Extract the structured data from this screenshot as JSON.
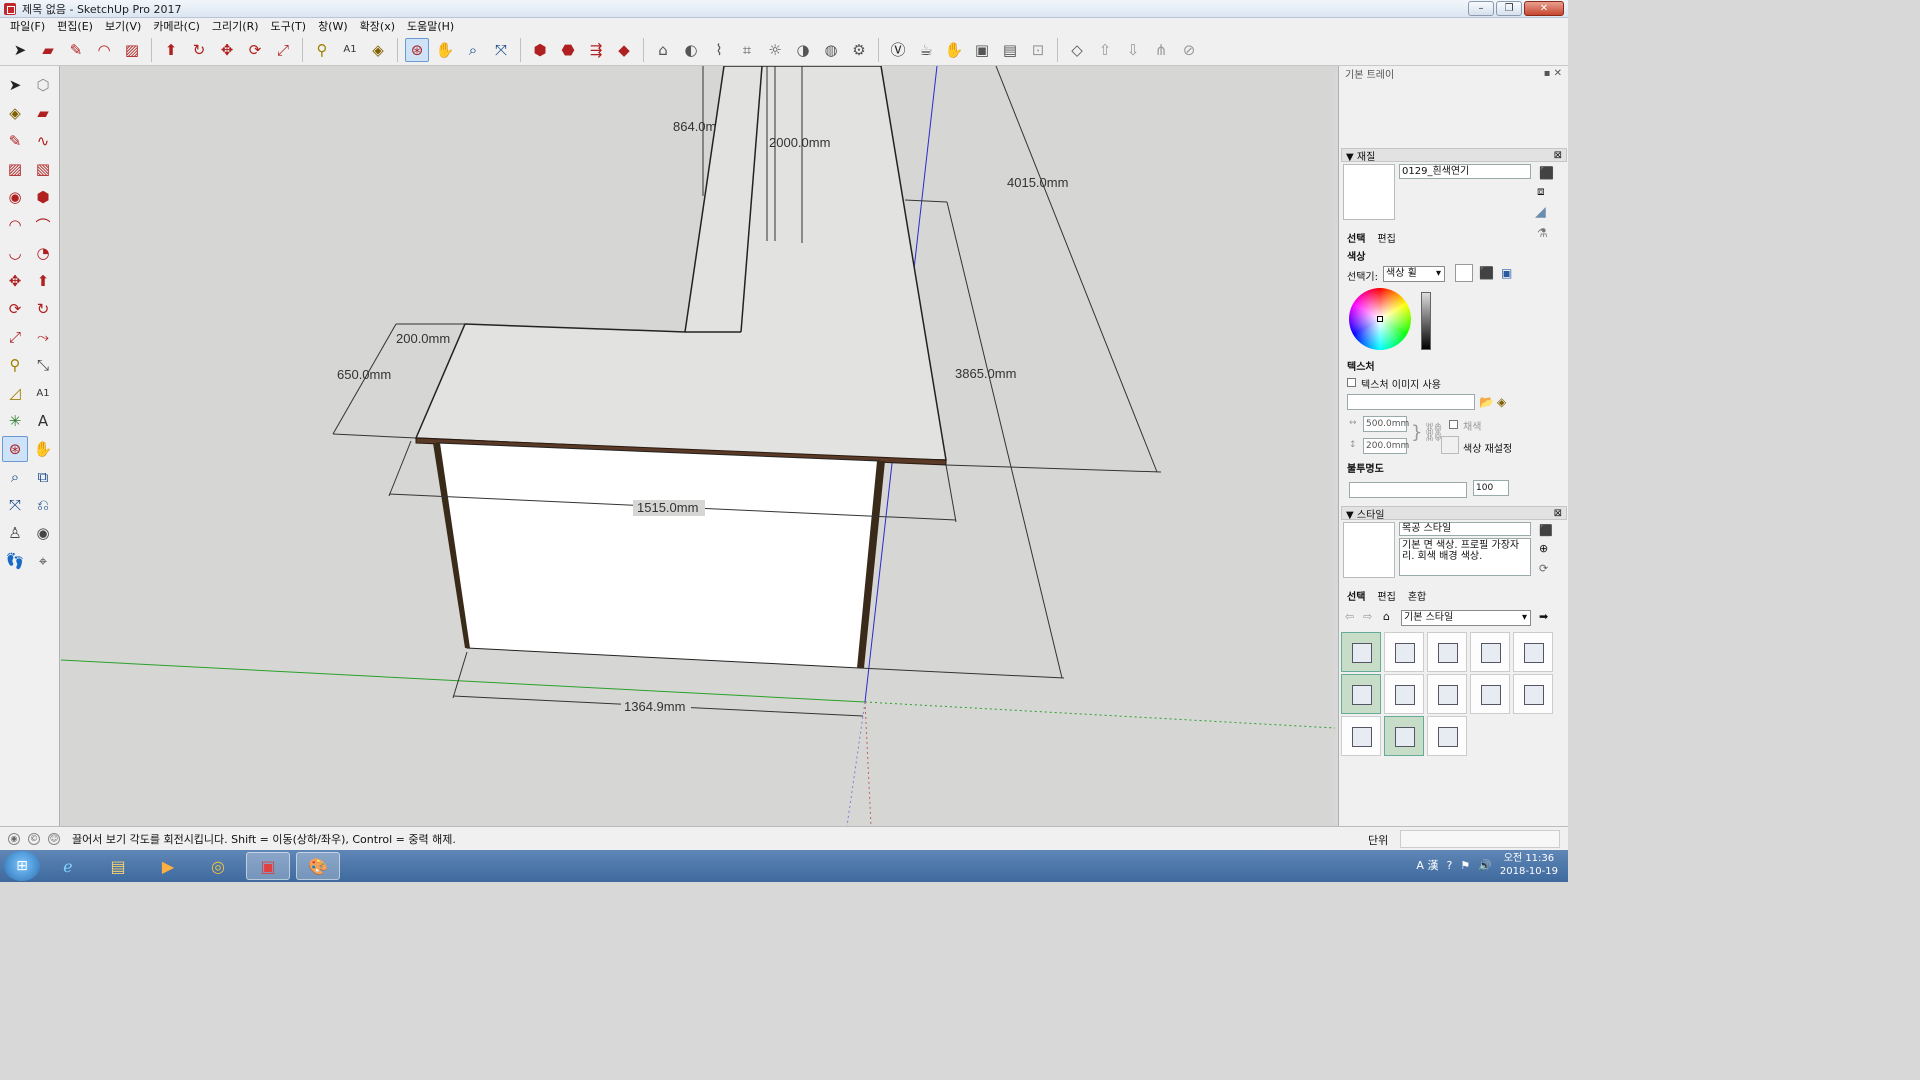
{
  "window": {
    "title": "제목 없음 - SketchUp Pro 2017",
    "buttons": [
      "–",
      "❐",
      "✕"
    ]
  },
  "menu": [
    "파일(F)",
    "편집(E)",
    "보기(V)",
    "카메라(C)",
    "그리기(R)",
    "도구(T)",
    "창(W)",
    "확장(x)",
    "도움말(H)"
  ],
  "dimensions": {
    "d864": "864.0m",
    "d2000": "2000.0mm",
    "d4015": "4015.0mm",
    "d200": "200.0mm",
    "d650": "650.0mm",
    "d3865": "3865.0mm",
    "d1515": "1515.0mm",
    "d1364": "1364.9mm"
  },
  "tray": {
    "title": "기본 트레이",
    "materials": {
      "header": "재질",
      "name": "0129_흰색연기",
      "tabs": [
        "선택",
        "편집"
      ],
      "color_label": "색상",
      "picker_label": "선택기:",
      "picker_value": "색상 휠",
      "texture_label": "텍스처",
      "use_texture": "텍스처 이미지 사용",
      "width": "500.0mm",
      "height": "200.0mm",
      "colorize": "채색",
      "reset_color": "색상 재설정",
      "opacity_label": "불투명도",
      "opacity_value": "100"
    },
    "styles": {
      "header": "스타일",
      "name": "목공 스타일",
      "description": "기본 면 색상. 프로필 가장자리. 회색 배경 색상.",
      "tabs": [
        "선택",
        "편집",
        "혼합"
      ],
      "library": "기본 스타일"
    }
  },
  "status": {
    "text": "끌어서 보기 각도를 회전시킵니다. Shift = 이동(상하/좌우), Control = 중력 해제.",
    "units_label": "단위"
  },
  "taskbar": {
    "time": "오전 11:36",
    "date": "2018-10-19"
  }
}
